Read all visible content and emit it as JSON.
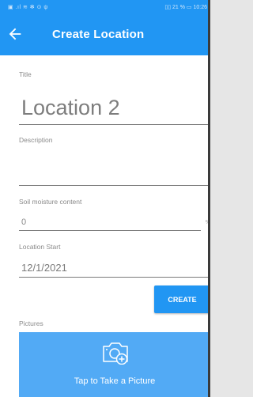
{
  "status_bar": {
    "left_icons": "▣ .ıl ≋ ✻ ⊙ ψ",
    "right_text": "▯▯ 21 % ▭ 10:26"
  },
  "app_bar": {
    "title": "Create Location",
    "back_icon": "arrow-left-icon",
    "color": "#2196f3"
  },
  "form": {
    "title_label": "Title",
    "title_value": "Location 2",
    "description_label": "Description",
    "description_value": "",
    "soil_label": "Soil moisture content",
    "soil_value": "0",
    "soil_unit": "%",
    "start_label": "Location Start",
    "start_value": "12/1/2021"
  },
  "create_button": {
    "label": "CREATE"
  },
  "pictures": {
    "label": "Pictures",
    "button_label": "Tap to Take a Picture",
    "icon": "add-camera-icon"
  }
}
